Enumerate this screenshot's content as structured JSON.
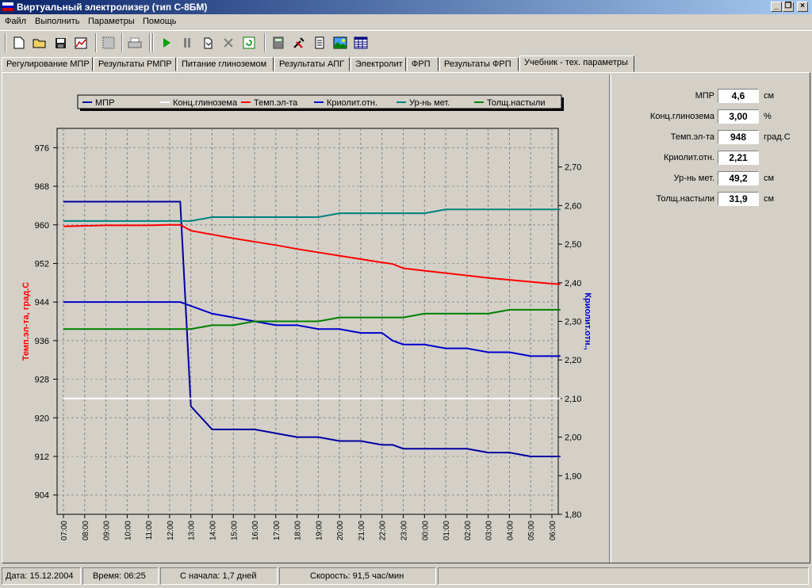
{
  "window": {
    "title": "Виртуальный электролизер (тип С-8БМ)"
  },
  "menu": [
    "Файл",
    "Выполнить",
    "Параметры",
    "Помощь"
  ],
  "toolbar_icons": [
    "new-icon",
    "open-icon",
    "save-icon",
    "chart-icon",
    "grid-icon",
    "print-icon",
    "play-icon",
    "pause-icon",
    "step-icon",
    "stop-icon",
    "refresh-icon",
    "calculator-icon",
    "tools-icon",
    "report-icon",
    "picture-icon",
    "table-icon"
  ],
  "tabs": [
    "Регулирование МПР",
    "Результаты РМПР",
    "Питание глиноземом",
    "Результаты АПГ",
    "Электролит",
    "ФРП",
    "Результаты ФРП",
    "Учебник - тех. параметры"
  ],
  "active_tab": 7,
  "params": [
    {
      "label": "МПР",
      "value": "4,6",
      "unit": "см"
    },
    {
      "label": "Конц.глинозема",
      "value": "3,00",
      "unit": "%"
    },
    {
      "label": "Темп.эл-та",
      "value": "948",
      "unit": "град.С"
    },
    {
      "label": "Криолит.отн.",
      "value": "2,21",
      "unit": ""
    },
    {
      "label": "Ур-нь мет.",
      "value": "49,2",
      "unit": "см"
    },
    {
      "label": "Толщ.настыли",
      "value": "31,9",
      "unit": "см"
    }
  ],
  "status": {
    "date": "Дата: 15.12.2004",
    "time": "Время: 06:25",
    "since": "С начала: 1,7 дней",
    "speed": "Скорость: 91,5 час/мин"
  },
  "chart_data": {
    "type": "line",
    "ylabel": "Темп.эл-та, град.С",
    "y2label": "Криолит.отн.,",
    "ylim": [
      900,
      980
    ],
    "y2lim": [
      1.8,
      2.8
    ],
    "yticks": [
      "976",
      "968",
      "960",
      "952",
      "944",
      "936",
      "928",
      "920",
      "912",
      "904"
    ],
    "y2ticks": [
      "2,70",
      "2,60",
      "2,50",
      "2,40",
      "2,30",
      "2,20",
      "2,10",
      "2,00",
      "1,90",
      "1,80"
    ],
    "xticks": [
      "07:00",
      "08:00",
      "09:00",
      "10:00",
      "11:00",
      "12:00",
      "13:00",
      "14:00",
      "15:00",
      "16:00",
      "17:00",
      "18:00",
      "19:00",
      "20:00",
      "21:00",
      "22:00",
      "23:00",
      "00:00",
      "01:00",
      "02:00",
      "03:00",
      "04:00",
      "05:00",
      "06:00"
    ],
    "grid": true,
    "legend_position": "top",
    "x": [
      0,
      1,
      2,
      3,
      4,
      5,
      5.5,
      6,
      7,
      8,
      9,
      10,
      11,
      12,
      13,
      14,
      15,
      15.5,
      16,
      17,
      18,
      19,
      20,
      21,
      22,
      23,
      23.4
    ],
    "series": [
      {
        "name": "МПР",
        "color": "#0000a0",
        "values": [
          2.61,
          2.61,
          2.61,
          2.61,
          2.61,
          2.61,
          2.61,
          2.08,
          2.02,
          2.02,
          2.02,
          2.01,
          2.0,
          2.0,
          1.99,
          1.99,
          1.98,
          1.98,
          1.97,
          1.97,
          1.97,
          1.97,
          1.96,
          1.96,
          1.95,
          1.95,
          1.95
        ]
      },
      {
        "name": "Конц.глинозема",
        "color": "#ffffff",
        "values": [
          2.1,
          2.1,
          2.1,
          2.1,
          2.1,
          2.1,
          2.1,
          2.1,
          2.1,
          2.1,
          2.1,
          2.1,
          2.1,
          2.1,
          2.1,
          2.1,
          2.1,
          2.1,
          2.1,
          2.1,
          2.1,
          2.1,
          2.1,
          2.1,
          2.1,
          2.1,
          2.1
        ]
      },
      {
        "name": "Темп.эл-та",
        "color": "#ff0000",
        "values": [
          959.7,
          959.8,
          959.9,
          959.9,
          959.9,
          960.0,
          960.0,
          958.8,
          958.0,
          957.2,
          956.5,
          955.8,
          955.0,
          954.3,
          953.6,
          952.9,
          952.2,
          951.9,
          951.0,
          950.5,
          950.0,
          949.5,
          949.0,
          948.6,
          948.2,
          947.8,
          947.7
        ]
      },
      {
        "name": "Криолит.отн.",
        "color": "#0000cc",
        "values": [
          2.35,
          2.35,
          2.35,
          2.35,
          2.35,
          2.35,
          2.35,
          2.34,
          2.32,
          2.31,
          2.3,
          2.29,
          2.29,
          2.28,
          2.28,
          2.27,
          2.27,
          2.25,
          2.24,
          2.24,
          2.23,
          2.23,
          2.22,
          2.22,
          2.21,
          2.21,
          2.21
        ]
      },
      {
        "name": "Ур-нь мет.",
        "color": "#008080",
        "values": [
          2.56,
          2.56,
          2.56,
          2.56,
          2.56,
          2.56,
          2.56,
          2.56,
          2.57,
          2.57,
          2.57,
          2.57,
          2.57,
          2.57,
          2.58,
          2.58,
          2.58,
          2.58,
          2.58,
          2.58,
          2.59,
          2.59,
          2.59,
          2.59,
          2.59,
          2.59,
          2.59
        ]
      },
      {
        "name": "Толщ.настыли",
        "color": "#008000",
        "values": [
          2.28,
          2.28,
          2.28,
          2.28,
          2.28,
          2.28,
          2.28,
          2.28,
          2.29,
          2.29,
          2.3,
          2.3,
          2.3,
          2.3,
          2.31,
          2.31,
          2.31,
          2.31,
          2.31,
          2.32,
          2.32,
          2.32,
          2.32,
          2.33,
          2.33,
          2.33,
          2.33
        ]
      }
    ]
  }
}
